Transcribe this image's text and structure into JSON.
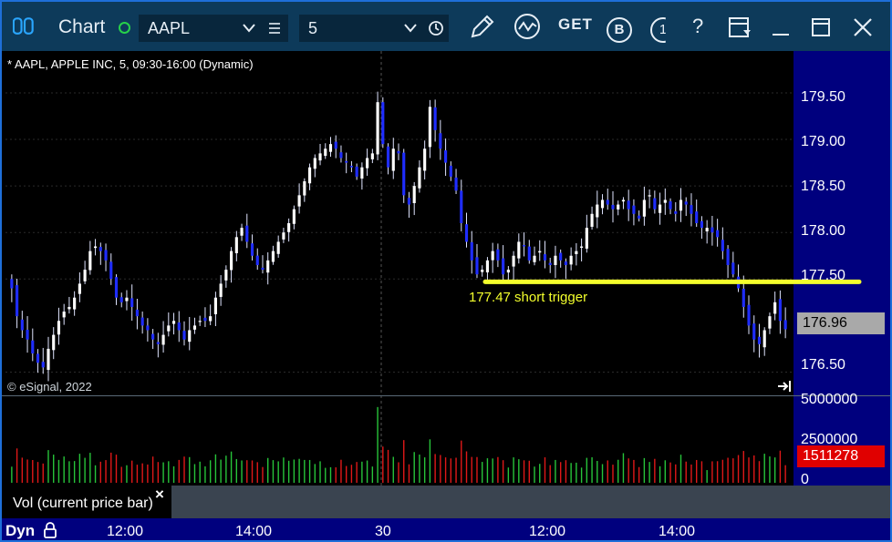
{
  "window": {
    "title": "Chart",
    "symbol": "AAPL",
    "interval": "5",
    "toolbar_get": "GET",
    "toolbar_b": "B",
    "toolbar_t": "1",
    "toolbar_help": "?"
  },
  "chart_header": "* AAPL, APPLE INC, 5, 09:30-16:00 (Dynamic)",
  "copyright": "© eSignal, 2022",
  "study_label": "Vol (current price bar)",
  "study_close": "×",
  "dyn_label": "Dyn",
  "annotation": "177.47 short trigger",
  "colors": {
    "up_bar": "#ffffff",
    "down_bar": "#1f2dff",
    "trigger_line": "#f3ff2c",
    "vol_up": "#27c43a",
    "vol_down": "#e01818"
  },
  "chart_data": [
    {
      "type": "candlestick",
      "title": "* AAPL, APPLE INC, 5, 09:30-16:00 (Dynamic)",
      "ylim": [
        176.25,
        179.95
      ],
      "y_ticks": [
        "179.50",
        "179.00",
        "178.50",
        "178.00",
        "177.50",
        "176.50"
      ],
      "x_ticks": [
        "12:00",
        "14:00",
        "30",
        "12:00",
        "14:00"
      ],
      "last_price": "176.96",
      "annotation_level": 177.47,
      "annotation_text": "177.47 short trigger",
      "closes": [
        177.4,
        177.1,
        176.95,
        176.85,
        176.7,
        176.6,
        176.55,
        176.75,
        176.9,
        177.05,
        177.15,
        177.2,
        177.3,
        177.45,
        177.6,
        177.8,
        177.85,
        177.8,
        177.7,
        177.5,
        177.3,
        177.25,
        177.3,
        177.2,
        177.1,
        177.0,
        176.95,
        176.85,
        176.8,
        176.9,
        177.0,
        177.05,
        176.95,
        176.85,
        176.95,
        177.0,
        177.05,
        177.05,
        177.1,
        177.3,
        177.45,
        177.6,
        177.8,
        177.95,
        178.05,
        177.9,
        177.75,
        177.65,
        177.6,
        177.7,
        177.8,
        177.9,
        178.0,
        178.1,
        178.25,
        178.4,
        178.55,
        178.7,
        178.8,
        178.85,
        178.9,
        178.95,
        178.9,
        178.8,
        178.75,
        178.7,
        178.6,
        178.7,
        178.8,
        178.85,
        179.4,
        178.95,
        178.7,
        178.9,
        178.85,
        178.4,
        178.3,
        178.5,
        178.7,
        178.9,
        179.35,
        179.1,
        178.9,
        178.75,
        178.6,
        178.45,
        178.1,
        177.9,
        177.7,
        177.55,
        177.6,
        177.7,
        177.8,
        177.7,
        177.55,
        177.6,
        177.75,
        177.9,
        177.85,
        177.7,
        177.75,
        177.8,
        177.7,
        177.65,
        177.75,
        177.7,
        177.65,
        177.75,
        177.8,
        177.85,
        178.05,
        178.2,
        178.3,
        178.35,
        178.3,
        178.25,
        178.3,
        178.35,
        178.25,
        178.2,
        178.15,
        178.35,
        178.4,
        178.25,
        178.3,
        178.35,
        178.25,
        178.2,
        178.35,
        178.3,
        178.2,
        178.1,
        178.05,
        178.05,
        178.0,
        177.95,
        177.8,
        177.65,
        177.55,
        177.4,
        177.2,
        177.0,
        176.85,
        176.8,
        176.95,
        177.1,
        177.25,
        177.05,
        176.96
      ]
    },
    {
      "type": "bar",
      "title": "Vol (current price bar)",
      "ylim": [
        0,
        5200000
      ],
      "y_ticks": [
        "5000000",
        "2500000",
        "0"
      ],
      "last_value": "1511278"
    }
  ]
}
